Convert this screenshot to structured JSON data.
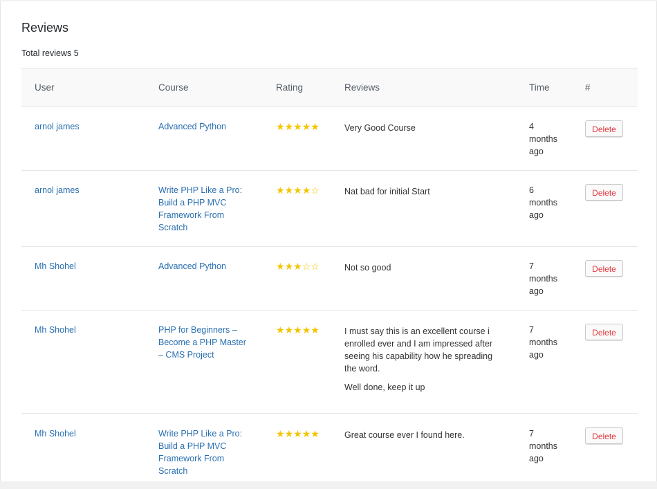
{
  "page": {
    "title": "Reviews",
    "total_label": "Total reviews 5"
  },
  "table": {
    "headers": [
      "User",
      "Course",
      "Rating",
      "Reviews",
      "Time",
      "#"
    ],
    "rows": [
      {
        "user": "arnol james",
        "course": "Advanced Python",
        "rating": 5,
        "review": [
          "Very Good Course"
        ],
        "time": "4 months ago",
        "action": "Delete"
      },
      {
        "user": "arnol james",
        "course": "Write PHP Like a Pro: Build a PHP MVC Framework From Scratch",
        "rating": 4,
        "review": [
          "Nat bad for initial Start"
        ],
        "time": "6 months ago",
        "action": "Delete"
      },
      {
        "user": "Mh Shohel",
        "course": "Advanced Python",
        "rating": 3,
        "review": [
          "Not so good"
        ],
        "time": "7 months ago",
        "action": "Delete"
      },
      {
        "user": "Mh Shohel",
        "course": "PHP for Beginners – Become a PHP Master – CMS Project",
        "rating": 5,
        "review": [
          "I must say this is an excellent course i enrolled ever and I am impressed after seeing his capability how he spreading the word.",
          "Well done, keep it up"
        ],
        "time": "7 months ago",
        "action": "Delete"
      },
      {
        "user": "Mh Shohel",
        "course": "Write PHP Like a Pro: Build a PHP MVC Framework From Scratch",
        "rating": 5,
        "review": [
          "Great course ever I found here."
        ],
        "time": "7 months ago",
        "action": "Delete"
      }
    ]
  },
  "colors": {
    "link": "#2a6fb0",
    "star": "#f5c400",
    "delete_text": "#e0383f"
  },
  "icons": {
    "star_filled": "star-icon",
    "star_empty": "star-outline-icon"
  }
}
